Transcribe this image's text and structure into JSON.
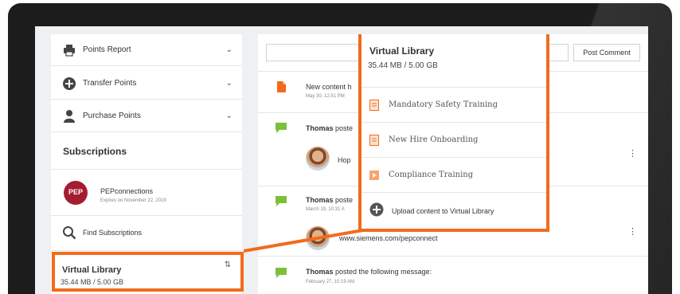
{
  "sidebar": {
    "menu": [
      {
        "label": "Points Report",
        "icon": "printer-icon"
      },
      {
        "label": "Transfer Points",
        "icon": "plus-circle-icon"
      },
      {
        "label": "Purchase Points",
        "icon": "user-icon"
      }
    ],
    "subscriptions_heading": "Subscriptions",
    "subscription": {
      "logo_text": "PEP",
      "name": "PEPconnections",
      "expires": "Expires on November 22, 2019"
    },
    "find_label": "Find Subscriptions",
    "virtual_library": {
      "title": "Virtual Library",
      "size": "35.44 MB / 5.00 GB"
    }
  },
  "feed": {
    "post_button": "Post Comment",
    "items": [
      {
        "type": "document",
        "text": "New content h",
        "date": "May 30, 12:51 PM"
      },
      {
        "type": "message",
        "author": "Thomas",
        "text": " poste",
        "reply": "Hop"
      },
      {
        "type": "message",
        "author": "Thomas",
        "text": " poste",
        "date": "March 19, 10:31 A",
        "reply": "www.siemens.com/pepconnect"
      },
      {
        "type": "message",
        "author": "Thomas",
        "text": " posted the following message:",
        "date": "February 27, 10:19 AM"
      }
    ]
  },
  "popup": {
    "title": "Virtual Library",
    "size": "35.44 MB / 5.00 GB",
    "items": [
      {
        "label": "Mandatory Safety Training",
        "icon": "document-icon"
      },
      {
        "label": "New Hire Onboarding",
        "icon": "document-icon"
      },
      {
        "label": "Compliance Training",
        "icon": "video-icon"
      }
    ],
    "upload_label": "Upload content to Virtual Library"
  },
  "colors": {
    "accent": "#f26b1d",
    "message_icon": "#7cc03a",
    "brand_red": "#a41c30"
  }
}
